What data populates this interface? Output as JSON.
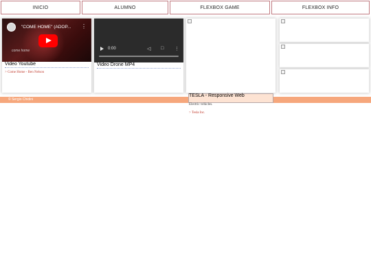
{
  "nav": {
    "items": [
      {
        "label": "INICIO"
      },
      {
        "label": "ALUMNO"
      },
      {
        "label": "FLEXBOX GAME"
      },
      {
        "label": "FLEXBOX INFO"
      }
    ]
  },
  "cards": {
    "youtube": {
      "player_title": "\"COME HOME\" (ADOP...",
      "player_caption": "come home",
      "title": "Video Youtube",
      "link": "> Come Home - Ben Nelson"
    },
    "drone": {
      "time": "0:00",
      "title": "Video Drone MP4"
    },
    "tesla": {
      "title": "TESLA - Responsive Web",
      "description": "Electric vehicles.",
      "link": "> Tesla Inc."
    }
  },
  "footer": {
    "text": "© Sergio Chidini"
  },
  "colors": {
    "nav_border": "#c07a80",
    "footer_bg": "#f6a77c",
    "link": "#c0392b",
    "tesla_panel_bg": "#fde3d3"
  }
}
